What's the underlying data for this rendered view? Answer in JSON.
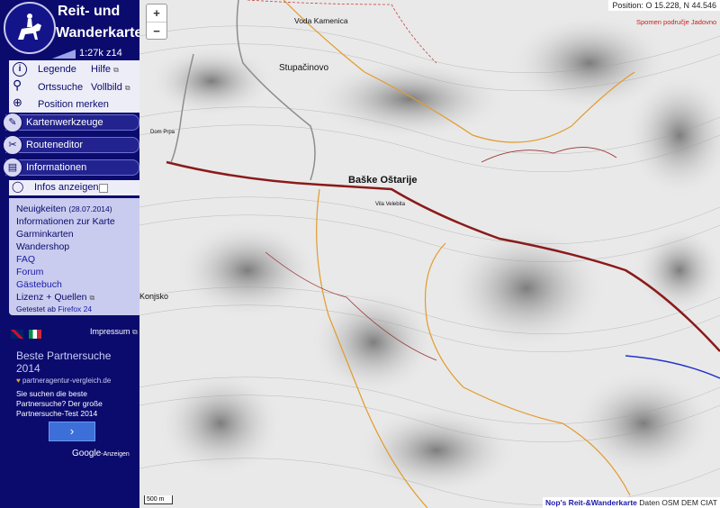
{
  "app": {
    "title_line1": "Reit- und",
    "title_line2": "Wanderkarte",
    "scale_text": "1:27k z14"
  },
  "tools": {
    "legend": "Legende",
    "help": "Hilfe",
    "search": "Ortssuche",
    "fullscreen": "Vollbild",
    "remember": "Position merken"
  },
  "sections": {
    "map_tools": "Kartenwerkzeuge",
    "route_editor": "Routeneditor",
    "info": "Informationen"
  },
  "infos_toggle": "Infos anzeigen",
  "info_links": {
    "news": "Neuigkeiten",
    "news_date": "(28.07.2014)",
    "about": "Informationen zur Karte",
    "garmin": "Garminkarten",
    "shop": "Wandershop",
    "faq": "FAQ",
    "forum": "Forum",
    "guestbook": "Gästebuch",
    "license": "Lizenz + Quellen",
    "tested_prefix": "Getestet ab",
    "tested_browser": "Firefox 24"
  },
  "impressum": "Impressum",
  "ad": {
    "title_l1": "Beste Partnersuche",
    "title_l2": "2014",
    "url": "partneragentur-vergleich.de",
    "text": "Sie suchen die beste Partnersuche? Der große Partnersuche-Test 2014",
    "button": "›",
    "google": "Google",
    "google_suffix": "-Anzeigen"
  },
  "map": {
    "zoom_in": "+",
    "zoom_out": "−",
    "position": "Position: O 15.228, N 44.546",
    "scale": "500 m",
    "attribution_name": "Nop's Reit-&Wanderkarte",
    "attribution_rest": " Daten OSM DEM CIAT",
    "labels": {
      "voda": "Voda Kamenica",
      "stupacinovo": "Stupačinovo",
      "dom": "Dom Prpa",
      "baske": "Baške Oštarije",
      "vila": "Vila Velebita",
      "sponem": "Spomen područje Jadovno",
      "konjsko": "Konjsko"
    }
  },
  "colors": {
    "sidebar": "#0b0b6e",
    "road_main": "#8b1a1a",
    "path_orange": "#e39a2a",
    "road_grey": "#8d8d8d"
  }
}
